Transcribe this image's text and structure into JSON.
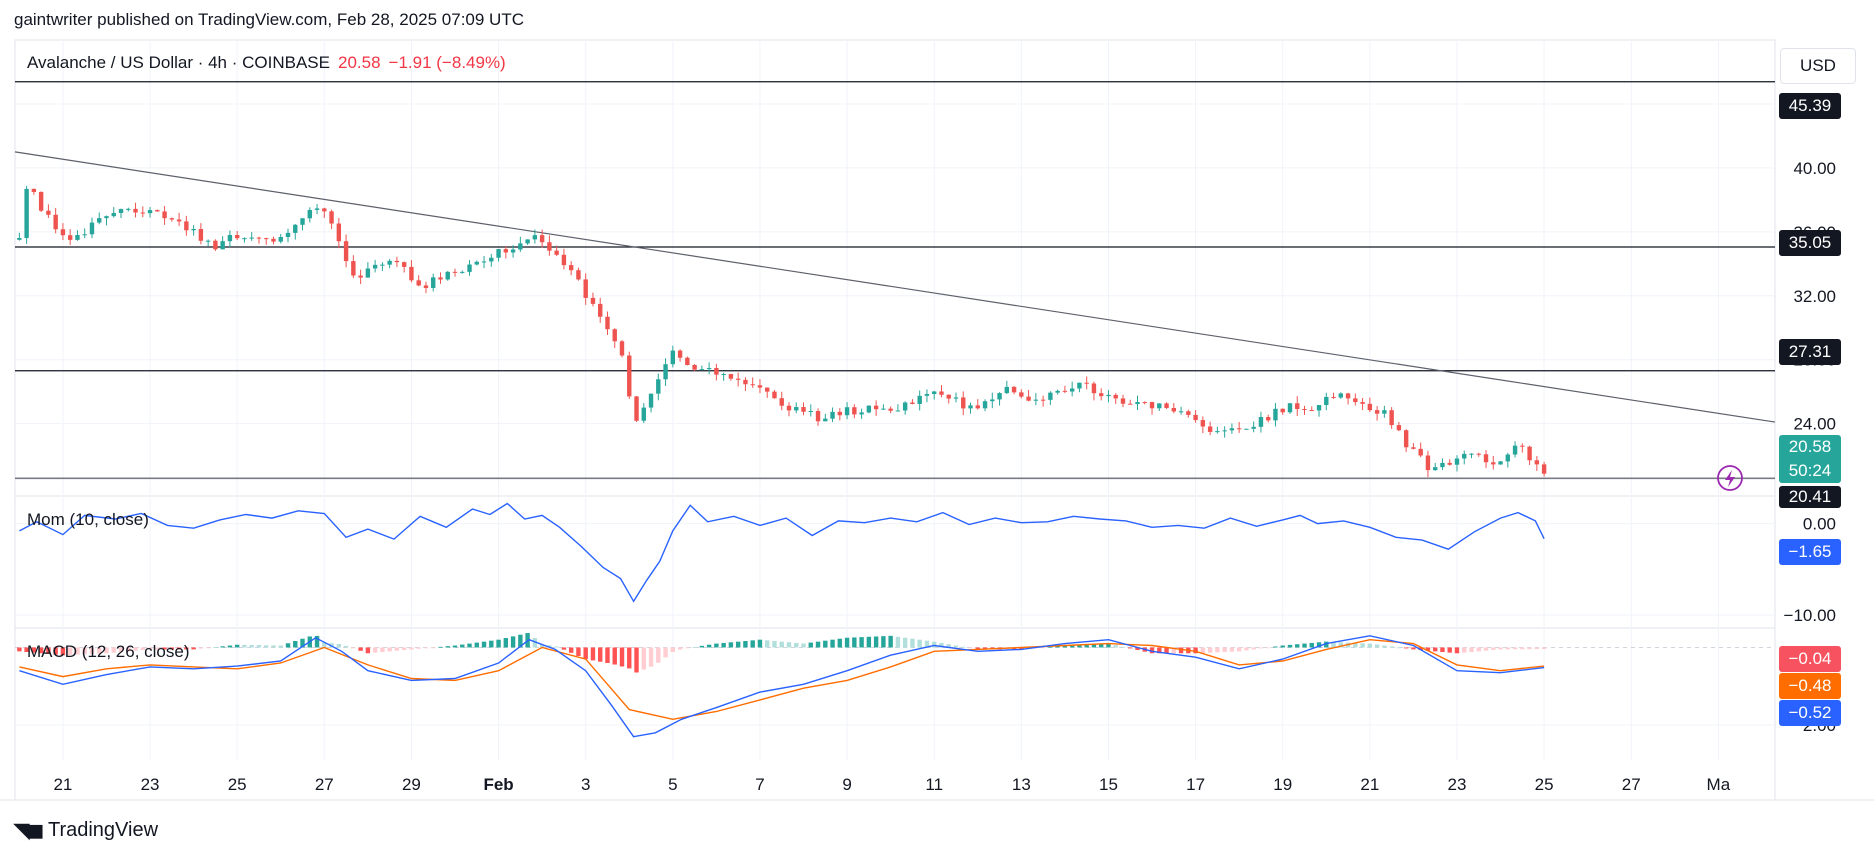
{
  "header": {
    "published": "gaintwriter published on TradingView.com, Feb 28, 2025 07:09 UTC"
  },
  "main": {
    "symbol": "Avalanche / US Dollar · 4h · COINBASE",
    "price": "20.58",
    "change": "−1.91 (−8.49%)",
    "currency": "USD",
    "price_tag": "20.58",
    "countdown": "50:24",
    "low_tag": "20.41",
    "levels": [
      {
        "label": "45.39",
        "value": 45.39
      },
      {
        "label": "35.05",
        "value": 35.05
      },
      {
        "label": "27.31",
        "value": 27.31
      }
    ]
  },
  "indicators": {
    "mom_label": "Mom (10, close)",
    "mom_value": "−1.65",
    "macd_label": "MACD (12, 26, close)",
    "macd_hist": "−0.04",
    "macd_signal": "−0.48",
    "macd_line": "−0.52"
  },
  "footer": {
    "brand": "TradingView"
  },
  "colors": {
    "up": "#26a69a",
    "down": "#ef5350",
    "blue": "#2962ff",
    "orange": "#ff6d00",
    "line_dark": "#131722",
    "grid": "#f0f3fa"
  },
  "chart_data": [
    {
      "type": "candlestick",
      "title": "Avalanche / US Dollar · 4h · COINBASE",
      "ylim": [
        19.6,
        48.0
      ],
      "y_ticks": [
        44,
        40,
        36,
        32,
        28,
        24
      ],
      "y_tick_labels": [
        "44.00",
        "40.00",
        "36.00",
        "32.00",
        "28.00",
        "24.00"
      ],
      "x_tick_labels": [
        "21",
        "23",
        "25",
        "27",
        "29",
        "Feb",
        "3",
        "5",
        "7",
        "9",
        "11",
        "13",
        "15",
        "17",
        "19",
        "21",
        "23",
        "25",
        "27",
        "Ma"
      ],
      "x_tick_days": [
        -11,
        -9,
        -7,
        -5,
        -3,
        -1,
        1,
        3,
        5,
        7,
        9,
        11,
        13,
        15,
        17,
        19,
        21,
        23,
        25,
        27,
        29
      ],
      "x_day_range": [
        -12.1,
        28.3
      ],
      "horizontal_levels": [
        45.39,
        35.05,
        27.31,
        20.58
      ],
      "trendline": {
        "from": [
          -12.1,
          41.0
        ],
        "to": [
          28.3,
          24.1
        ]
      },
      "close_path": [
        [
          -12.0,
          35.5
        ],
        [
          -11.8,
          39.2
        ],
        [
          -11.4,
          37.0
        ],
        [
          -10.8,
          35.2
        ],
        [
          -10.2,
          36.7
        ],
        [
          -9.5,
          37.3
        ],
        [
          -8.8,
          37.3
        ],
        [
          -8.2,
          36.3
        ],
        [
          -7.5,
          35.0
        ],
        [
          -7.0,
          35.8
        ],
        [
          -6.3,
          35.4
        ],
        [
          -5.8,
          36.0
        ],
        [
          -5.3,
          37.6
        ],
        [
          -4.9,
          37.2
        ],
        [
          -4.6,
          35.0
        ],
        [
          -4.3,
          33.2
        ],
        [
          -3.8,
          33.7
        ],
        [
          -3.3,
          34.2
        ],
        [
          -2.8,
          32.5
        ],
        [
          -2.2,
          33.3
        ],
        [
          -1.6,
          34.0
        ],
        [
          -1.0,
          34.8
        ],
        [
          -0.4,
          35.4
        ],
        [
          -0.2,
          35.9
        ],
        [
          0.3,
          34.6
        ],
        [
          0.7,
          33.5
        ],
        [
          1.1,
          31.5
        ],
        [
          1.6,
          29.8
        ],
        [
          1.9,
          27.6
        ],
        [
          2.1,
          23.7
        ],
        [
          2.4,
          25.4
        ],
        [
          2.7,
          26.8
        ],
        [
          3.0,
          28.5
        ],
        [
          3.4,
          27.3
        ],
        [
          3.9,
          27.2
        ],
        [
          4.5,
          26.9
        ],
        [
          5.0,
          26.2
        ],
        [
          5.4,
          25.2
        ],
        [
          5.9,
          25.0
        ],
        [
          6.4,
          24.2
        ],
        [
          7.0,
          24.8
        ],
        [
          7.5,
          24.9
        ],
        [
          8.0,
          24.7
        ],
        [
          8.5,
          25.5
        ],
        [
          9.0,
          26.2
        ],
        [
          9.6,
          25.2
        ],
        [
          10.1,
          25.0
        ],
        [
          10.6,
          26.4
        ],
        [
          11.2,
          25.6
        ],
        [
          11.8,
          25.9
        ],
        [
          12.3,
          26.6
        ],
        [
          12.8,
          25.8
        ],
        [
          13.3,
          25.4
        ],
        [
          13.9,
          25.2
        ],
        [
          14.4,
          25.0
        ],
        [
          14.9,
          24.5
        ],
        [
          15.4,
          23.4
        ],
        [
          15.9,
          23.5
        ],
        [
          16.4,
          24.1
        ],
        [
          16.9,
          24.8
        ],
        [
          17.2,
          25.2
        ],
        [
          17.5,
          24.6
        ],
        [
          17.9,
          25.3
        ],
        [
          18.4,
          25.9
        ],
        [
          18.9,
          25.0
        ],
        [
          19.4,
          24.6
        ],
        [
          19.9,
          22.4
        ],
        [
          20.4,
          21.2
        ],
        [
          20.9,
          21.7
        ],
        [
          21.4,
          22.0
        ],
        [
          21.9,
          21.5
        ],
        [
          22.3,
          22.7
        ],
        [
          22.6,
          22.2
        ],
        [
          23.0,
          20.6
        ]
      ]
    },
    {
      "type": "line",
      "title": "Mom (10, close)",
      "ylim": [
        -11.2,
        2.8
      ],
      "y_ticks": [
        0,
        -10
      ],
      "y_tick_labels": [
        "0.00",
        "−10.00"
      ],
      "series": [
        {
          "name": "Mom",
          "values_path": [
            [
              -12.0,
              -0.8
            ],
            [
              -11.6,
              0.2
            ],
            [
              -11.0,
              -1.2
            ],
            [
              -10.5,
              0.9
            ],
            [
              -9.8,
              0.5
            ],
            [
              -9.2,
              1.1
            ],
            [
              -8.6,
              -0.2
            ],
            [
              -8.0,
              -0.5
            ],
            [
              -7.4,
              0.4
            ],
            [
              -6.8,
              1.0
            ],
            [
              -6.2,
              0.6
            ],
            [
              -5.6,
              1.4
            ],
            [
              -5.0,
              1.1
            ],
            [
              -4.5,
              -1.5
            ],
            [
              -4.0,
              -0.6
            ],
            [
              -3.4,
              -1.7
            ],
            [
              -2.8,
              0.8
            ],
            [
              -2.2,
              -0.4
            ],
            [
              -1.6,
              1.6
            ],
            [
              -1.2,
              1.0
            ],
            [
              -0.8,
              2.2
            ],
            [
              -0.4,
              0.5
            ],
            [
              0.0,
              0.9
            ],
            [
              0.4,
              -0.4
            ],
            [
              0.9,
              -2.5
            ],
            [
              1.4,
              -4.8
            ],
            [
              1.8,
              -6.0
            ],
            [
              2.1,
              -8.5
            ],
            [
              2.4,
              -6.2
            ],
            [
              2.7,
              -4.1
            ],
            [
              3.0,
              -0.8
            ],
            [
              3.4,
              2.0
            ],
            [
              3.8,
              0.2
            ],
            [
              4.4,
              0.8
            ],
            [
              5.0,
              -0.2
            ],
            [
              5.6,
              0.6
            ],
            [
              6.2,
              -1.3
            ],
            [
              6.8,
              0.3
            ],
            [
              7.4,
              0.1
            ],
            [
              8.0,
              0.6
            ],
            [
              8.6,
              0.2
            ],
            [
              9.2,
              1.2
            ],
            [
              9.8,
              -0.1
            ],
            [
              10.4,
              0.6
            ],
            [
              11.0,
              0.1
            ],
            [
              11.6,
              0.2
            ],
            [
              12.2,
              0.8
            ],
            [
              12.8,
              0.5
            ],
            [
              13.4,
              0.3
            ],
            [
              14.0,
              -0.4
            ],
            [
              14.6,
              -0.2
            ],
            [
              15.2,
              -0.5
            ],
            [
              15.8,
              0.6
            ],
            [
              16.4,
              -0.3
            ],
            [
              17.0,
              0.4
            ],
            [
              17.4,
              0.9
            ],
            [
              17.8,
              0.0
            ],
            [
              18.4,
              0.3
            ],
            [
              19.0,
              -0.4
            ],
            [
              19.6,
              -1.5
            ],
            [
              20.2,
              -1.8
            ],
            [
              20.8,
              -2.8
            ],
            [
              21.4,
              -0.9
            ],
            [
              22.0,
              0.6
            ],
            [
              22.4,
              1.2
            ],
            [
              22.8,
              0.3
            ],
            [
              23.0,
              -1.65
            ]
          ]
        }
      ]
    },
    {
      "type": "line",
      "title": "MACD (12, 26, close)",
      "ylim": [
        -2.9,
        0.45
      ],
      "y_ticks": [
        -2
      ],
      "y_tick_labels": [
        "−2.00"
      ],
      "series": [
        {
          "name": "MACD",
          "values_path": [
            [
              -12.0,
              -0.6
            ],
            [
              -11.0,
              -0.95
            ],
            [
              -10.0,
              -0.7
            ],
            [
              -9.0,
              -0.5
            ],
            [
              -8.0,
              -0.55
            ],
            [
              -7.0,
              -0.48
            ],
            [
              -6.0,
              -0.35
            ],
            [
              -5.2,
              0.25
            ],
            [
              -4.6,
              -0.1
            ],
            [
              -4.0,
              -0.6
            ],
            [
              -3.0,
              -0.85
            ],
            [
              -2.0,
              -0.8
            ],
            [
              -1.0,
              -0.4
            ],
            [
              -0.3,
              0.2
            ],
            [
              0.3,
              -0.05
            ],
            [
              1.0,
              -0.6
            ],
            [
              1.6,
              -1.5
            ],
            [
              2.1,
              -2.3
            ],
            [
              2.6,
              -2.2
            ],
            [
              3.2,
              -1.85
            ],
            [
              4.0,
              -1.55
            ],
            [
              5.0,
              -1.15
            ],
            [
              6.0,
              -0.95
            ],
            [
              7.0,
              -0.6
            ],
            [
              8.0,
              -0.2
            ],
            [
              9.0,
              0.05
            ],
            [
              10.0,
              -0.1
            ],
            [
              11.0,
              -0.05
            ],
            [
              12.0,
              0.1
            ],
            [
              13.0,
              0.2
            ],
            [
              14.0,
              -0.1
            ],
            [
              15.0,
              -0.25
            ],
            [
              16.0,
              -0.55
            ],
            [
              17.0,
              -0.3
            ],
            [
              18.0,
              0.1
            ],
            [
              19.0,
              0.3
            ],
            [
              20.0,
              0.05
            ],
            [
              21.0,
              -0.6
            ],
            [
              22.0,
              -0.65
            ],
            [
              23.0,
              -0.52
            ]
          ]
        },
        {
          "name": "Signal",
          "values_path": [
            [
              -12.0,
              -0.5
            ],
            [
              -11.0,
              -0.75
            ],
            [
              -10.0,
              -0.55
            ],
            [
              -9.0,
              -0.45
            ],
            [
              -8.0,
              -0.5
            ],
            [
              -7.0,
              -0.55
            ],
            [
              -6.0,
              -0.4
            ],
            [
              -5.0,
              0.0
            ],
            [
              -4.0,
              -0.45
            ],
            [
              -3.0,
              -0.8
            ],
            [
              -2.0,
              -0.85
            ],
            [
              -1.0,
              -0.6
            ],
            [
              0.0,
              0.0
            ],
            [
              1.0,
              -0.3
            ],
            [
              2.0,
              -1.6
            ],
            [
              3.0,
              -1.85
            ],
            [
              4.0,
              -1.65
            ],
            [
              5.0,
              -1.35
            ],
            [
              6.0,
              -1.05
            ],
            [
              7.0,
              -0.85
            ],
            [
              8.0,
              -0.5
            ],
            [
              9.0,
              -0.1
            ],
            [
              10.0,
              -0.05
            ],
            [
              11.0,
              0.0
            ],
            [
              12.0,
              0.05
            ],
            [
              13.0,
              0.1
            ],
            [
              14.0,
              0.05
            ],
            [
              15.0,
              -0.1
            ],
            [
              16.0,
              -0.45
            ],
            [
              17.0,
              -0.35
            ],
            [
              18.0,
              -0.05
            ],
            [
              19.0,
              0.2
            ],
            [
              20.0,
              0.1
            ],
            [
              21.0,
              -0.45
            ],
            [
              22.0,
              -0.6
            ],
            [
              23.0,
              -0.48
            ]
          ]
        }
      ]
    }
  ]
}
